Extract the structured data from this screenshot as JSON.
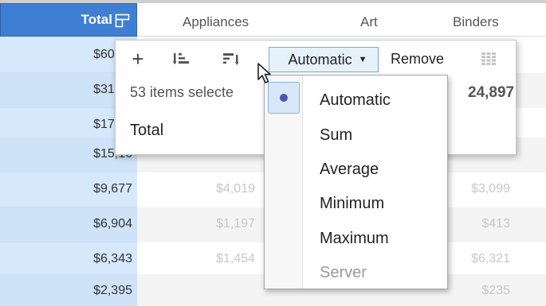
{
  "columns": {
    "total": "Total",
    "appliances": "Appliances",
    "art": "Art",
    "binders": "Binders"
  },
  "rows": [
    {
      "total": "$60,77",
      "appliances": "",
      "art": "",
      "binders": ""
    },
    {
      "total": "$31,68",
      "appliances": "",
      "art": "",
      "binders": ""
    },
    {
      "total": "$17,53",
      "appliances": "",
      "art": "",
      "binders": ""
    },
    {
      "total": "$15,16",
      "appliances": "",
      "art": "",
      "binders": ""
    },
    {
      "total": "$9,677",
      "appliances": "$4,019",
      "art": "",
      "binders": "$3,099"
    },
    {
      "total": "$6,904",
      "appliances": "$1,197",
      "art": "",
      "binders": "$413"
    },
    {
      "total": "$6,343",
      "appliances": "$1,454",
      "art": "",
      "binders": "$6,321"
    },
    {
      "total": "$2,395",
      "appliances": "",
      "art": "",
      "binders": "$235"
    }
  ],
  "popup": {
    "aggregation_label": "Automatic",
    "remove_label": "Remove",
    "selection_text": "53 items selecte",
    "total_label": "Total",
    "background_value": "24,897"
  },
  "dropdown": {
    "options": [
      "Automatic",
      "Sum",
      "Average",
      "Minimum",
      "Maximum",
      "Server"
    ],
    "selected": "Automatic"
  },
  "icons": {
    "add": "plus-icon",
    "sort_ascending": "sort-ascending-icon",
    "sort_descending": "sort-descending-icon",
    "grid": "grid-icon",
    "column_menu": "column-menu-icon",
    "cursor": "mouse-pointer-icon"
  },
  "colors": {
    "header_accent": "#3f7fd3",
    "total_column": "#d6e8fb",
    "selected_option": "#d9e8f9",
    "radio_dot": "#4b52b8"
  }
}
